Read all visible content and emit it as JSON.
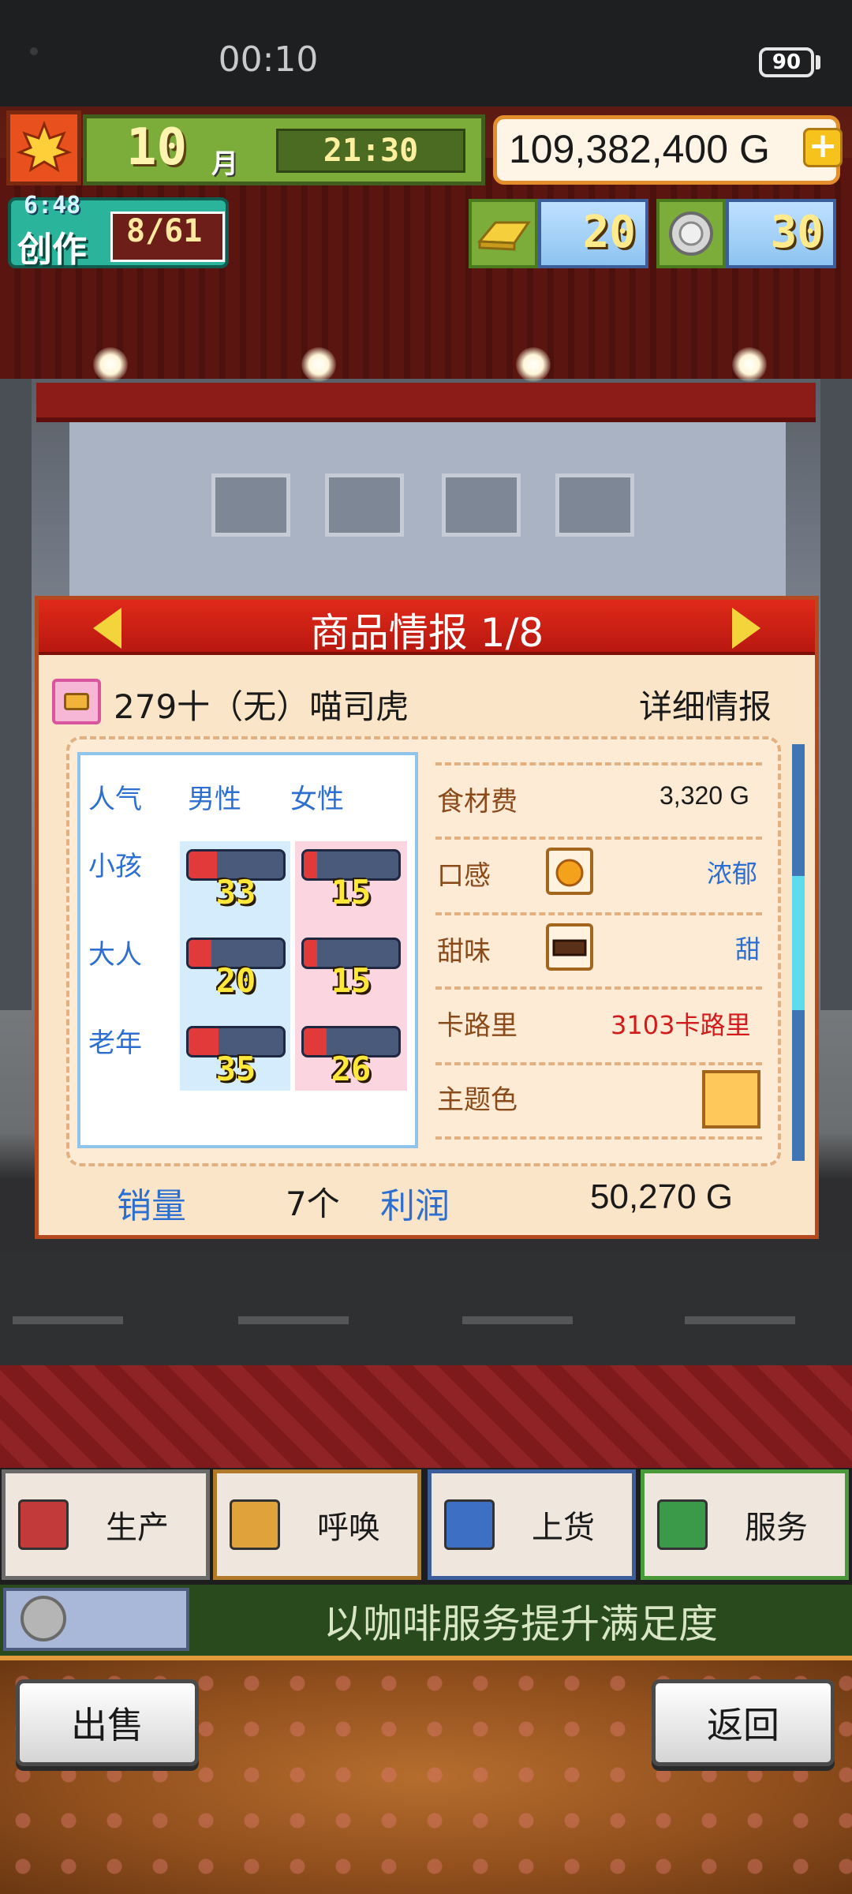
{
  "status_bar": {
    "time": "00:10",
    "battery": "90"
  },
  "hud": {
    "month": "10",
    "month_unit": "月",
    "time": "21:30",
    "money": "109,382,400 G",
    "create": {
      "timer": "6:48",
      "label": "创作",
      "count": "8/61"
    },
    "gold_bars": "20",
    "silver_medals": "30"
  },
  "dialog": {
    "title": "商品情报 1/8",
    "item_name": "279十（无）喵司虎",
    "detail_link": "详细情报",
    "popularity": {
      "headers": [
        "人气",
        "男性",
        "女性"
      ],
      "rows": [
        {
          "label": "小孩",
          "male": "33",
          "female": "15"
        },
        {
          "label": "大人",
          "male": "20",
          "female": "15"
        },
        {
          "label": "老年",
          "male": "35",
          "female": "26"
        }
      ]
    },
    "specs": {
      "cost_label": "食材费",
      "cost_value": "3,320 G",
      "texture_label": "口感",
      "texture_value": "浓郁",
      "sweetness_label": "甜味",
      "sweetness_value": "甜",
      "calorie_label": "卡路里",
      "calorie_value": "3103卡路里",
      "theme_label": "主题色",
      "theme_color": "#ffc85a"
    },
    "sales_label": "销量",
    "sales_value": "7个",
    "profit_label": "利润",
    "profit_value": "50,270 G"
  },
  "menu": {
    "produce": "生产",
    "summon": "呼唤",
    "restock": "上货",
    "service": "服务"
  },
  "tip": "以咖啡服务提升满足度",
  "buttons": {
    "sell": "出售",
    "back": "返回"
  },
  "colors": {
    "accent_red": "#d42516",
    "label_blue": "#2d6fd0",
    "calorie_red": "#d41b1b",
    "tip_bar": "#284a1d"
  }
}
